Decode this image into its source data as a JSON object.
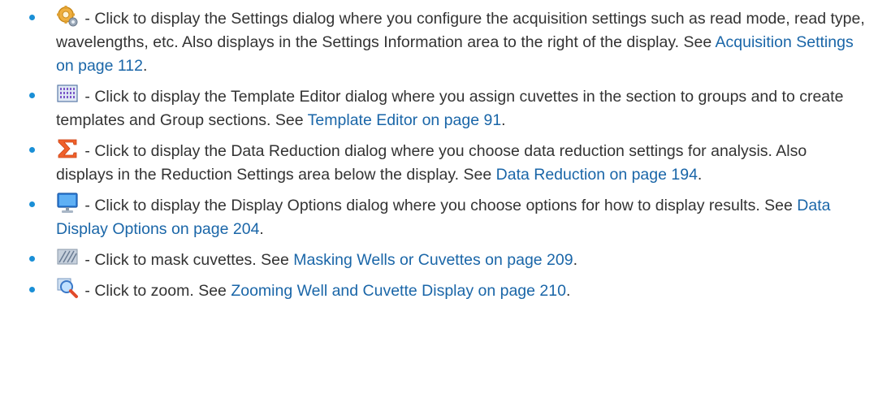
{
  "items": [
    {
      "icon": "settings-gear-icon",
      "text": " - Click to display the Settings dialog where you configure the acquisition settings such as read mode, read type, wavelengths, etc. Also displays in the Settings Information area to the right of the display. See ",
      "link": "Acquisition Settings on page 112",
      "after": "."
    },
    {
      "icon": "template-grid-icon",
      "text": " - Click to display the Template Editor dialog where you assign cuvettes in the section to groups and to create templates and Group sections. See ",
      "link": "Template Editor on page 91",
      "after": "."
    },
    {
      "icon": "sigma-icon",
      "text": " - Click to display the Data Reduction dialog where you choose data reduction settings for analysis. Also displays in the Reduction Settings area below the display. See ",
      "link": "Data Reduction on page 194",
      "after": "."
    },
    {
      "icon": "monitor-icon",
      "text": " - Click to display the Display Options dialog where you choose options for how to display results. See ",
      "link": "Data Display Options on page 204",
      "after": "."
    },
    {
      "icon": "mask-icon",
      "text": " - Click to mask cuvettes. See ",
      "link": "Masking Wells or Cuvettes on page 209",
      "after": "."
    },
    {
      "icon": "zoom-icon",
      "text": " - Click to zoom. See ",
      "link": "Zooming Well and Cuvette Display on page 210",
      "after": "."
    }
  ],
  "colors": {
    "text": "#333333",
    "link": "#1a66a8",
    "bullet": "#1a8fd6"
  }
}
